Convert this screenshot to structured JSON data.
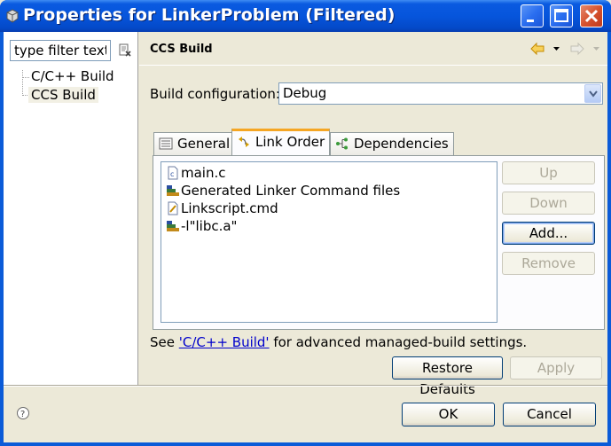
{
  "window": {
    "title": "Properties for LinkerProblem (Filtered)",
    "buttons": {
      "minimize": "minimize",
      "maximize": "maximize",
      "close": "close"
    }
  },
  "sidebar": {
    "filter_placeholder": "type filter text",
    "items": [
      {
        "label": "C/C++ Build",
        "selected": false
      },
      {
        "label": "CCS Build",
        "selected": true
      }
    ]
  },
  "page": {
    "title": "CCS Build",
    "build_config_label": "Build configuration:",
    "build_config_value": "Debug"
  },
  "tabs": [
    {
      "label": "General",
      "icon": "general-icon",
      "active": false
    },
    {
      "label": "Link Order",
      "icon": "link-order-icon",
      "active": true
    },
    {
      "label": "Dependencies",
      "icon": "dependencies-icon",
      "active": false
    }
  ],
  "link_order": {
    "items": [
      {
        "label": "main.c",
        "icon": "c-file-icon"
      },
      {
        "label": "Generated Linker Command files",
        "icon": "library-icon"
      },
      {
        "label": "Linkscript.cmd",
        "icon": "cmd-file-icon"
      },
      {
        "label": "-l\"libc.a\"",
        "icon": "library-icon"
      }
    ],
    "buttons": {
      "up": "Up",
      "down": "Down",
      "add": "Add...",
      "remove": "Remove"
    }
  },
  "footer_note": {
    "prefix": "See ",
    "link": "'C/C++ Build'",
    "suffix": " for advanced managed-build settings."
  },
  "page_buttons": {
    "restore_defaults": "Restore Defaults",
    "apply": "Apply"
  },
  "dialog_buttons": {
    "ok": "OK",
    "cancel": "Cancel"
  },
  "colors": {
    "titlebar": "#0655dc",
    "dialog_bg": "#ece9d8",
    "active_tab_accent": "#f5a623",
    "link": "#0000cc"
  }
}
